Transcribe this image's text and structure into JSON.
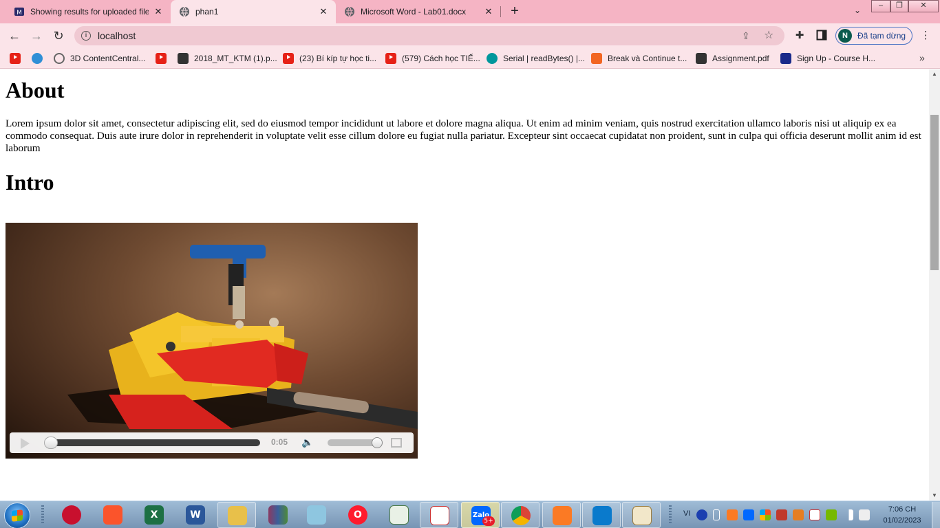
{
  "browser": {
    "tabs": [
      {
        "title": "Showing results for uploaded file",
        "active": false,
        "icon": "upload-favicon"
      },
      {
        "title": "phan1",
        "active": true,
        "icon": "globe-favicon"
      },
      {
        "title": "Microsoft Word - Lab01.docx",
        "active": false,
        "icon": "globe-favicon"
      }
    ],
    "new_tab_label": "+",
    "address": "localhost",
    "profile": {
      "initial": "N",
      "status": "Đã tạm dừng"
    },
    "bookmarks": [
      {
        "label": "",
        "icon": "youtube-icon"
      },
      {
        "label": "",
        "icon": "wifi-icon"
      },
      {
        "label": "3D ContentCentral...",
        "icon": "compass-icon"
      },
      {
        "label": "",
        "icon": "youtube-icon"
      },
      {
        "label": "2018_MT_KTM (1).p...",
        "icon": "globe-icon"
      },
      {
        "label": "(23) Bí kíp tự học ti...",
        "icon": "youtube-icon"
      },
      {
        "label": "(579) Cách học TIẾ...",
        "icon": "youtube-icon"
      },
      {
        "label": "Serial | readBytes() |...",
        "icon": "arduino-icon"
      },
      {
        "label": "Break và Continue t...",
        "icon": "f8-icon"
      },
      {
        "label": "Assignment.pdf",
        "icon": "globe-icon"
      },
      {
        "label": "Sign Up - Course H...",
        "icon": "star-badge-icon"
      }
    ],
    "colors": {
      "tabstrip": "#f5b4c4",
      "toolbar": "#fbe4e9",
      "omnibox": "#f0c9d2"
    }
  },
  "page": {
    "about_heading": "About",
    "about_text": "Lorem ipsum dolor sit amet, consectetur adipiscing elit, sed do eiusmod tempor incididunt ut labore et dolore magna aliqua. Ut enim ad minim veniam, quis nostrud exercitation ullamco laboris nisi ut aliquip ex ea commodo consequat. Duis aute irure dolor in reprehenderit in voluptate velit esse cillum dolore eu fugiat nulla pariatur. Excepteur sint occaecat cupidatat non proident, sunt in culpa qui officia deserunt mollit anim id est laborum",
    "intro_heading": "Intro",
    "video": {
      "time": "0:05",
      "progress": 0.0,
      "volume": 1.0
    }
  },
  "taskbar": {
    "apps": [
      "opera-gx-icon",
      "brave-icon",
      "excel-icon",
      "word-icon",
      "file-explorer-icon",
      "winrar-icon",
      "notepad-icon",
      "opera-icon",
      "sheet-icon",
      "unikey-icon",
      "zalo-icon",
      "chrome-icon",
      "xampp-icon",
      "vscode-icon",
      "paint-icon"
    ],
    "zalo_badge": "5+",
    "zalo_label": "Zalo",
    "language": "VI",
    "time": "7:06 CH",
    "date": "01/02/2023"
  }
}
